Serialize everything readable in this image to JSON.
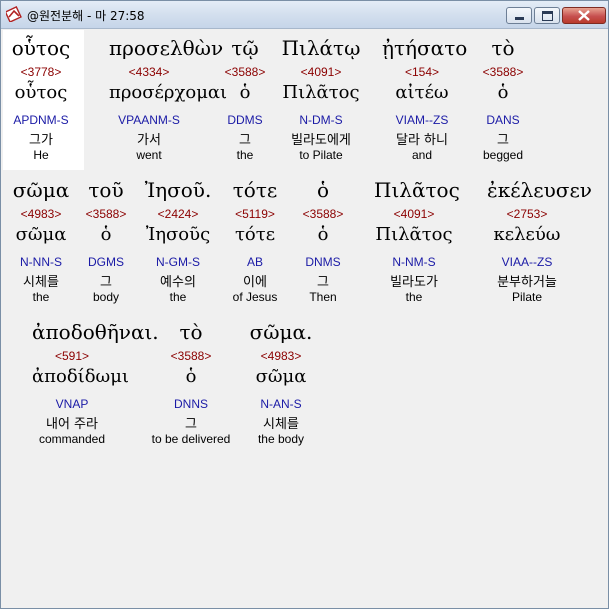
{
  "window": {
    "title": "@원전분해 - 마 27:58"
  },
  "rows": [
    [
      {
        "greek": "οὗτος",
        "strong": "<3778>",
        "lemma": "οὗτος",
        "parse": "APDNM-S",
        "korean": "그가",
        "english": "He"
      },
      {
        "greek": "προσελθὼν",
        "strong": "<4334>",
        "lemma": "προσέρχομαι",
        "parse": "VPAANM-S",
        "korean": "가서",
        "english": "went"
      },
      {
        "greek": "τῷ",
        "strong": "<3588>",
        "lemma": "ὁ",
        "parse": "DDMS",
        "korean": "그",
        "english": "the"
      },
      {
        "greek": "Πιλάτῳ",
        "strong": "<4091>",
        "lemma": "Πιλᾶτος",
        "parse": "N-DM-S",
        "korean": "빌라도에게",
        "english": "to Pilate"
      },
      {
        "greek": "ᾐτήσατο",
        "strong": "<154>",
        "lemma": "αἰτέω",
        "parse": "VIAM--ZS",
        "korean": "달라 하니",
        "english": "and"
      },
      {
        "greek": "τὸ",
        "strong": "<3588>",
        "lemma": "ὁ",
        "parse": "DANS",
        "korean": "그",
        "english": "begged"
      }
    ],
    [
      {
        "greek": "σῶμα",
        "strong": "<4983>",
        "lemma": "σῶμα",
        "parse": "N-NN-S",
        "korean": "시체를",
        "english": "the"
      },
      {
        "greek": "τοῦ",
        "strong": "<3588>",
        "lemma": "ὁ",
        "parse": "DGMS",
        "korean": "그",
        "english": "body"
      },
      {
        "greek": "Ἰησοῦ.",
        "strong": "<2424>",
        "lemma": "Ἰησοῦς",
        "parse": "N-GM-S",
        "korean": "예수의",
        "english": "the"
      },
      {
        "greek": "τότε",
        "strong": "<5119>",
        "lemma": "τότε",
        "parse": "AB",
        "korean": "이에",
        "english": "of Jesus"
      },
      {
        "greek": "ὁ",
        "strong": "<3588>",
        "lemma": "ὁ",
        "parse": "DNMS",
        "korean": "그",
        "english": "Then"
      },
      {
        "greek": "Πιλᾶτος",
        "strong": "<4091>",
        "lemma": "Πιλᾶτος",
        "parse": "N-NM-S",
        "korean": "빌라도가",
        "english": "the"
      },
      {
        "greek": "ἐκέλευσεν",
        "strong": "<2753>",
        "lemma": "κελεύω",
        "parse": "VIAA--ZS",
        "korean": "분부하거늘",
        "english": "Pilate"
      }
    ],
    [
      {
        "greek": "ἀποδοθῆναι.",
        "strong": "<591>",
        "lemma": "ἀποδίδωμι",
        "parse": "VNAP",
        "korean": "내어 주라",
        "english": "commanded"
      },
      {
        "greek": "τὸ",
        "strong": "<3588>",
        "lemma": "ὁ",
        "parse": "DNNS",
        "korean": "그",
        "english": "to be delivered"
      },
      {
        "greek": "σῶμα.",
        "strong": "<4983>",
        "lemma": "σῶμα",
        "parse": "N-AN-S",
        "korean": "시체를",
        "english": "the body"
      }
    ]
  ]
}
